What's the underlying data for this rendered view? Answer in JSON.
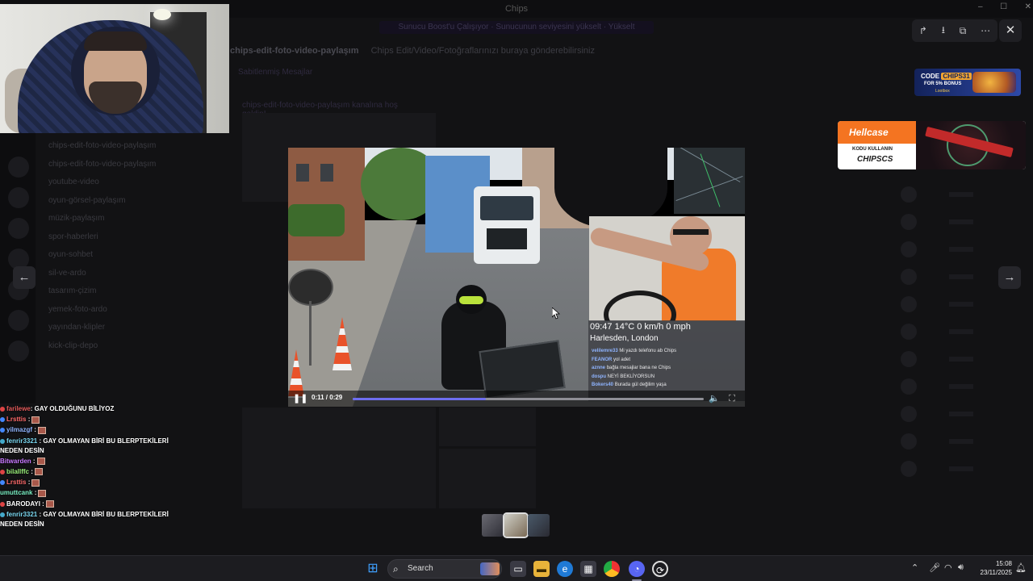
{
  "window": {
    "title": "Chips"
  },
  "background_app": {
    "banner": "Sunucu Boost'u Çalışıyor · Sunucunun seviyesini yükselt · Yükselt",
    "channel_header": {
      "name": "chips-edit-foto-video-paylaşım",
      "topic": "Chips Edit/Video/Fotoğraflarınızı buraya gönderebilirsiniz"
    },
    "pinned_label": "Sabitlenmiş Mesajlar",
    "first_message": "chips-edit-foto-video-paylaşım kanalına hoş geldin!",
    "channels": [
      "chips-edit-foto-video-paylaşım",
      "chips-edit-foto-video-paylaşım",
      "youtube-video",
      "oyun-görsel-paylaşım",
      "müzik-paylaşım",
      "spor-haberleri",
      "oyun-sohbet",
      "sil-ve-ardo",
      "tasarım-çizim",
      "yemek-foto-ardo",
      "yayından-klipler",
      "kick-clip-depo"
    ]
  },
  "chat": {
    "lines": [
      {
        "user": "farilewe",
        "color": "#e25a5a",
        "text": ": GAY OLDUĞUNU BİLİYOZ",
        "emote": false
      },
      {
        "user": "Lrsttis",
        "color": "#ff6b6b",
        "text": ":",
        "emote": true
      },
      {
        "user": "yilmazgf",
        "color": "#8fb4ff",
        "text": ":",
        "emote": true
      },
      {
        "user": "fenrir3321",
        "color": "#7ad7f0",
        "text": ": GAY OLMAYAN BİRİ BU BLERPTEKİLERİ",
        "emote": false
      },
      {
        "user": "",
        "color": "#fff",
        "text": "NEDEN DESİN",
        "emote": false
      },
      {
        "user": "Bitwarden",
        "color": "#c879ff",
        "text": ":",
        "emote": true
      },
      {
        "user": "bilallffc",
        "color": "#9af07a",
        "text": ":",
        "emote": true
      },
      {
        "user": "Lrsttis",
        "color": "#ff6b6b",
        "text": ":",
        "emote": true
      },
      {
        "user": "umuttcank",
        "color": "#7af0c4",
        "text": ":",
        "emote": true
      },
      {
        "user": "BARODAYI",
        "color": "#ffffff",
        "text": ":",
        "emote": true
      },
      {
        "user": "fenrir3321",
        "color": "#7ad7f0",
        "text": ": GAY OLMAYAN BİRİ BU BLERPTEKİLERİ",
        "emote": false
      },
      {
        "user": "",
        "color": "#fff",
        "text": "NEDEN DESİN",
        "emote": false
      }
    ]
  },
  "ads": {
    "lootbox": {
      "prefix": "CODE",
      "code": "CHIPS31",
      "line2": "FOR 5% BONUS",
      "brand": "Lootbox"
    },
    "hellcase": {
      "brand": "Hellcase",
      "line1": "KODU KULLANIN",
      "line2": "CHIPSCS"
    }
  },
  "video": {
    "overlay_speed": "09:47  14°C  0 km/h   0 mph",
    "overlay_location": "Harlesden, London",
    "overlay_chat": [
      {
        "user": "velilemre33",
        "text": "Mi yazdı telefonu ab Chips"
      },
      {
        "user": "FEANOR",
        "text": "yol adet"
      },
      {
        "user": "aznne",
        "text": "bağla mesajlar bana ne Chips"
      },
      {
        "user": "dospu",
        "text": "NEYİ BEKLİYORSUN"
      },
      {
        "user": "Bokers40",
        "text": "Burada gül değilim yaşa"
      }
    ],
    "current_time": "0:11",
    "duration": "0:29",
    "time_label": "0:11 / 0:29",
    "progress": 0.38
  },
  "modal": {
    "prev_label": "←",
    "next_label": "→",
    "close_label": "✕",
    "actions": [
      "↱",
      "⭳",
      "⧉",
      "⋯"
    ]
  },
  "taskbar": {
    "search_label": "Search",
    "time": "15:08",
    "date": "23/11/2025"
  }
}
